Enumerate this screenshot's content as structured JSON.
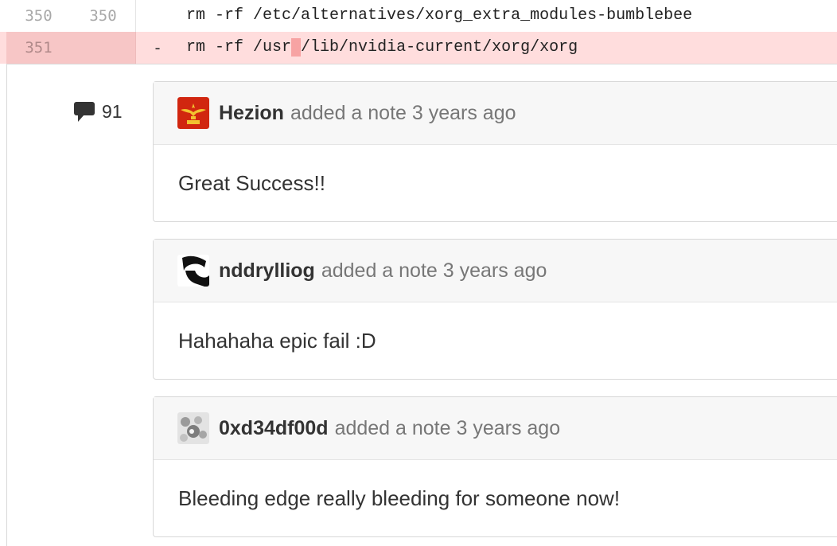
{
  "diff": {
    "lines": [
      {
        "old_no": "350",
        "new_no": "350",
        "marker": "",
        "code": "rm -rf /etc/alternatives/xorg_extra_modules-bumblebee"
      },
      {
        "old_no": "351",
        "new_no": "",
        "marker": "-",
        "code_before": "rm -rf /usr",
        "code_highlight": " ",
        "code_after": "/lib/nvidia-current/xorg/xorg"
      }
    ]
  },
  "comment_count": "91",
  "notes": [
    {
      "author": "Hezion",
      "meta": "added a note 3 years ago",
      "body": "Great Success!!"
    },
    {
      "author": "nddrylliog",
      "meta": "added a note 3 years ago",
      "body": "Hahahaha epic fail :D"
    },
    {
      "author": "0xd34df00d",
      "meta": "added a note 3 years ago",
      "body": "Bleeding edge really bleeding for someone now!"
    }
  ],
  "colors": {
    "deleted_bg": "#ffdddd",
    "highlight": "#f7a3a3",
    "avatar_red": "#d1260f"
  }
}
